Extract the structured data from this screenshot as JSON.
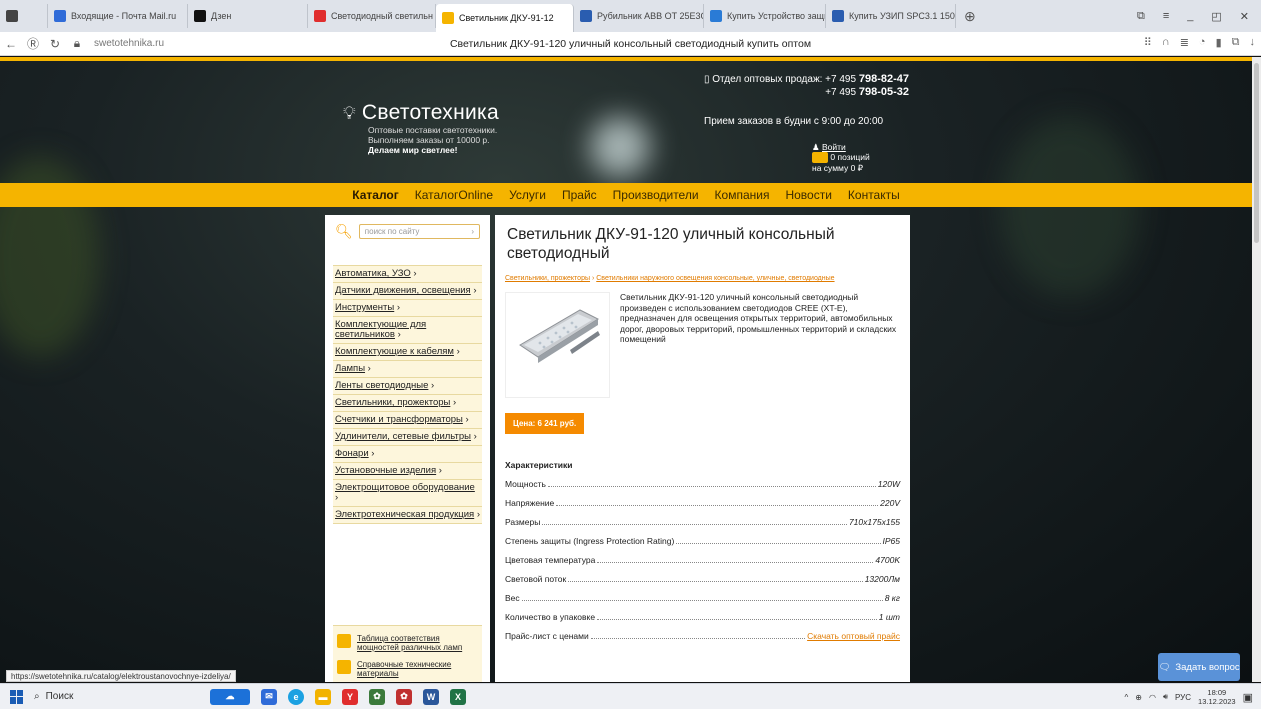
{
  "tabs": [
    {
      "label": "",
      "icon": "browser-menu-icon",
      "color": "#444"
    },
    {
      "label": "Входящие - Почта Mail.ru",
      "icon": "mail-icon",
      "color": "#2f6bd8"
    },
    {
      "label": "Дзен",
      "icon": "zen-icon",
      "color": "#111"
    },
    {
      "label": "Светодиодный светильн",
      "icon": "yandex-icon",
      "color": "#e02d2d"
    },
    {
      "label": "Светильник ДКУ-91-12",
      "icon": "svetotehnika-icon",
      "color": "#f5b400",
      "active": true
    },
    {
      "label": "Рубильник ABB OT 25E3C",
      "icon": "rub-icon",
      "color": "#2a5db0"
    },
    {
      "label": "Купить Устройство защит",
      "icon": "globe-icon",
      "color": "#2a7bd6"
    },
    {
      "label": "Купить УЗИП SPC3.1 150",
      "icon": "grid-icon",
      "color": "#2a5db0"
    }
  ],
  "address": {
    "url": "swetotehnika.ru",
    "page_title": "Светильник ДКУ-91-120 уличный консольный светодиодный купить оптом"
  },
  "header": {
    "logo_name": "Светотехника",
    "logo_sub1": "Оптовые поставки светотехники.",
    "logo_sub2": "Выполняем заказы от 10000 р.",
    "logo_slogan": "Делаем мир светлее!",
    "phone_label": "Отдел оптовых продаж: +7 495",
    "phone1": "798-82-47",
    "phone2_prefix": "+7 495",
    "phone2": "798-05-32",
    "hours": "Прием заказов в будни с 9:00 до 20:00",
    "login": "Войти",
    "cart_count": "0 позиций",
    "cart_sum": "на сумму 0 ₽"
  },
  "menu": [
    "Каталог",
    "КаталогOnline",
    "Услуги",
    "Прайс",
    "Производители",
    "Компания",
    "Новости",
    "Контакты"
  ],
  "search": {
    "placeholder": "поиск по сайту"
  },
  "categories": [
    "Автоматика, УЗО",
    "Датчики движения, освещения",
    "Инструменты",
    "Комплектующие для светильников",
    "Комплектующие к кабелям",
    "Лампы",
    "Ленты светодиодные",
    "Светильники, прожекторы",
    "Счетчики и трансформаторы",
    "Удлинители, сетевые фильтры",
    "Фонари",
    "Установочные изделия",
    "Электрощитовое оборудование",
    "Электротехническая продукция"
  ],
  "misc": [
    "Таблица соответствия мощностей различных ламп",
    "Справочные технические материалы"
  ],
  "product": {
    "title": "Светильник ДКУ-91-120 уличный консольный светодиодный",
    "breadcrumb1": "Светильники, прожекторы",
    "breadcrumb2": "Светильники наружного освещения консольные, уличные, светодиодные",
    "description": "Светильник ДКУ-91-120 уличный консольный светодиодный произведен с использованием светодиодов CREE (XT-E), предназначен для освещения открытых территорий, автомобильных дорог, дворовых территорий, промышленных территорий и складских помещений",
    "price": "Цена: 6 241 руб.",
    "chars_heading": "Характеристики",
    "specs": [
      {
        "name": "Мощность",
        "value": "120W"
      },
      {
        "name": "Напряжение",
        "value": "220V"
      },
      {
        "name": "Размеры",
        "value": "710x175x155"
      },
      {
        "name": "Степень защиты (Ingress Protection Rating)",
        "value": "IP65"
      },
      {
        "name": "Цветовая температура",
        "value": "4700K"
      },
      {
        "name": "Световой поток",
        "value": "13200Лм"
      },
      {
        "name": "Вес",
        "value": "8 кг"
      },
      {
        "name": "Количество в упаковке",
        "value": "1 шт"
      },
      {
        "name": "Прайс-лист с ценами",
        "value": "Скачать оптовый прайс",
        "link": true
      }
    ]
  },
  "status_url": "https://swetotehnika.ru/catalog/elektroustanovochnye-izdeliya/",
  "ask_button": "Задать вопрос",
  "taskbar": {
    "search": "Поиск",
    "lang": "РУС",
    "time": "18:09",
    "date": "13.12.2023"
  }
}
